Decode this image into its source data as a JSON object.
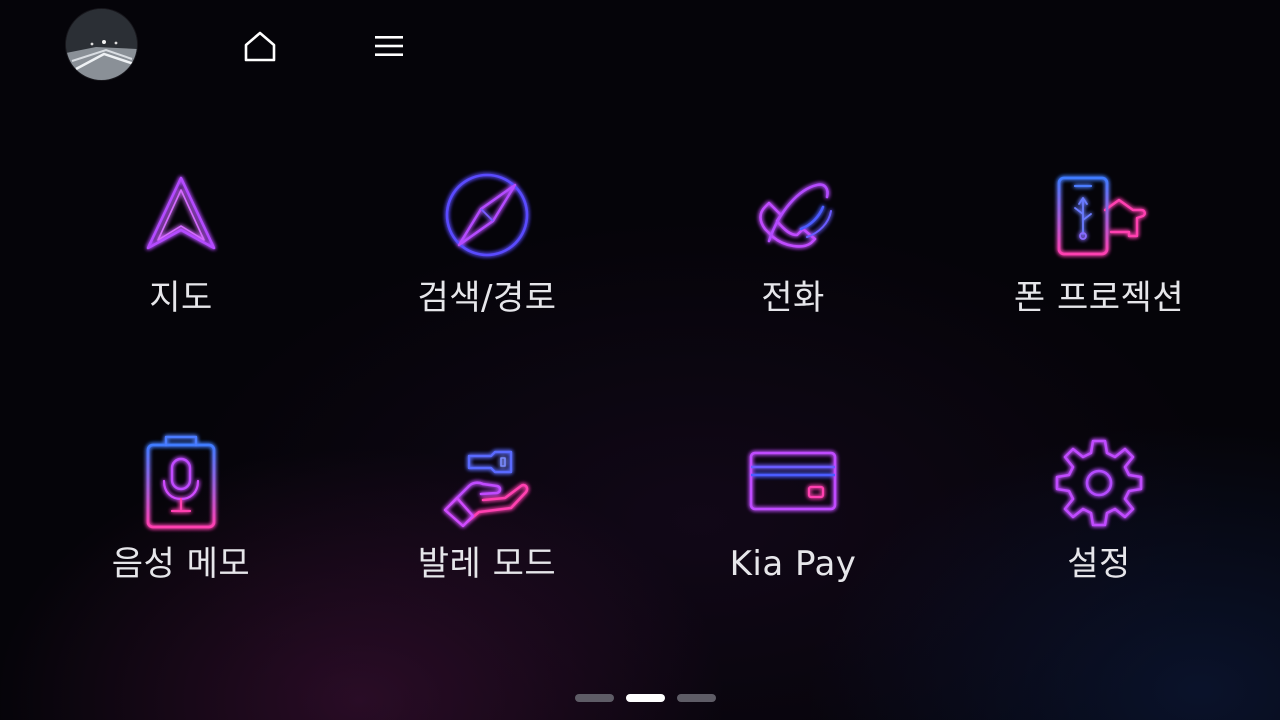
{
  "header": {
    "avatar": "profile-avatar",
    "home_icon": "home-icon",
    "menu_icon": "hamburger-menu-icon"
  },
  "apps": [
    {
      "label": "지도",
      "icon": "navigation-arrow-icon"
    },
    {
      "label": "검색/경로",
      "icon": "compass-icon"
    },
    {
      "label": "전화",
      "icon": "phone-icon"
    },
    {
      "label": "폰 프로젝션",
      "icon": "phone-projection-icon"
    },
    {
      "label": "음성 메모",
      "icon": "voice-memo-icon"
    },
    {
      "label": "발레 모드",
      "icon": "valet-mode-icon"
    },
    {
      "label": "Kia Pay",
      "icon": "credit-card-icon"
    },
    {
      "label": "설정",
      "icon": "settings-gear-icon"
    }
  ],
  "pager": {
    "count": 3,
    "active_index": 1
  },
  "colors": {
    "background": "#050409",
    "neon_purple": "#b44bff",
    "neon_blue": "#4b5bff",
    "neon_pink": "#ff3fb0",
    "label": "#e6e6ea",
    "pager_inactive": "#5e5c66",
    "pager_active": "#ffffff"
  }
}
